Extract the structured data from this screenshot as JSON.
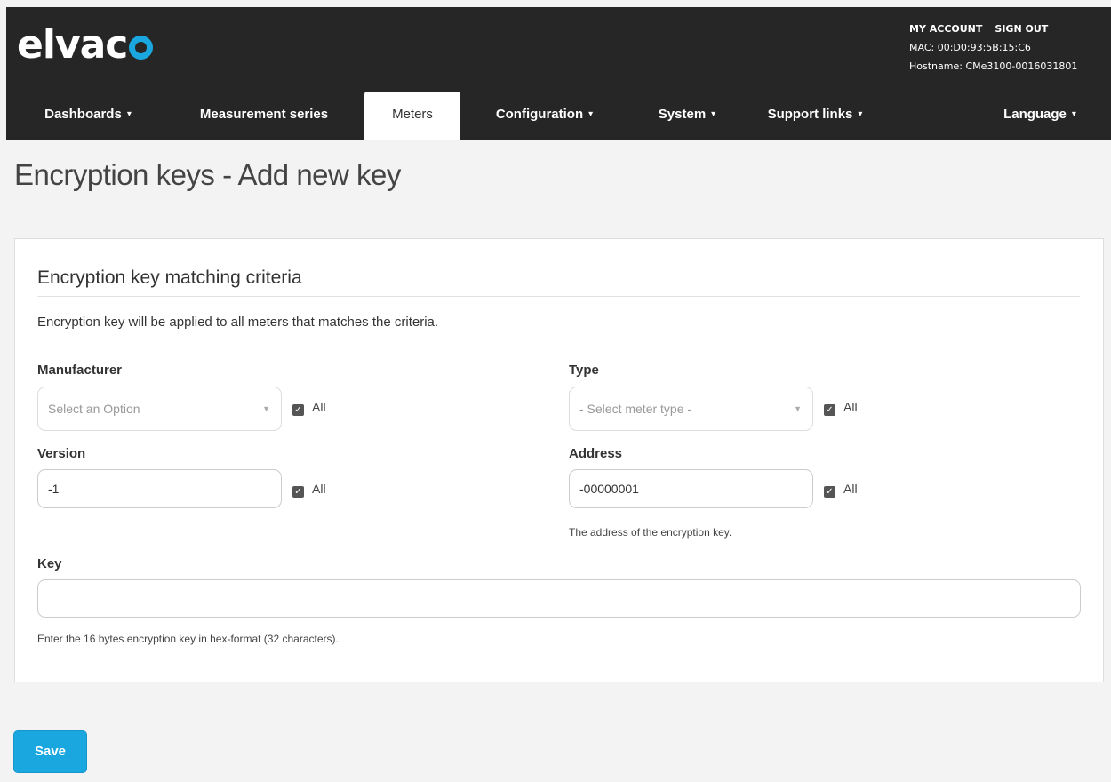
{
  "header": {
    "logo_text": "elvac",
    "links": [
      "MY ACCOUNT",
      "SIGN OUT"
    ],
    "mac": "MAC: 00:D0:93:5B:15:C6",
    "hostname": "Hostname: CMe3100-0016031801"
  },
  "nav": {
    "items": [
      {
        "label": "Dashboards",
        "caret": "▾"
      },
      {
        "label": "Measurement series",
        "caret": ""
      },
      {
        "label": "Meters",
        "caret": ""
      },
      {
        "label": "Configuration",
        "caret": "▾"
      },
      {
        "label": "System",
        "caret": "▾"
      },
      {
        "label": "Support links",
        "caret": "▾"
      },
      {
        "label": "Language",
        "caret": "▾"
      }
    ],
    "active": "Meters"
  },
  "page": {
    "title": "Encryption keys - Add new key"
  },
  "criteria": {
    "section_title": "Encryption key matching criteria",
    "description": "Encryption key will be applied to all meters that matches the criteria.",
    "manufacturer": {
      "label": "Manufacturer",
      "placeholder": "Select an Option",
      "all_label": "All",
      "all_checked": true
    },
    "type": {
      "label": "Type",
      "placeholder": "- Select meter type -",
      "all_label": "All",
      "all_checked": true
    },
    "version": {
      "label": "Version",
      "value": "-1",
      "all_label": "All",
      "all_checked": true
    },
    "address": {
      "label": "Address",
      "value": "-00000001",
      "all_label": "All",
      "all_checked": true,
      "help": "The address of the encryption key."
    },
    "key": {
      "label": "Key",
      "value": "",
      "help": "Enter the 16 bytes encryption key in hex-format (32 characters)."
    }
  },
  "actions": {
    "save_label": "Save"
  },
  "colors": {
    "header_bg": "#262626",
    "accent": "#1aa6df",
    "page_bg": "#f3f3f3"
  }
}
